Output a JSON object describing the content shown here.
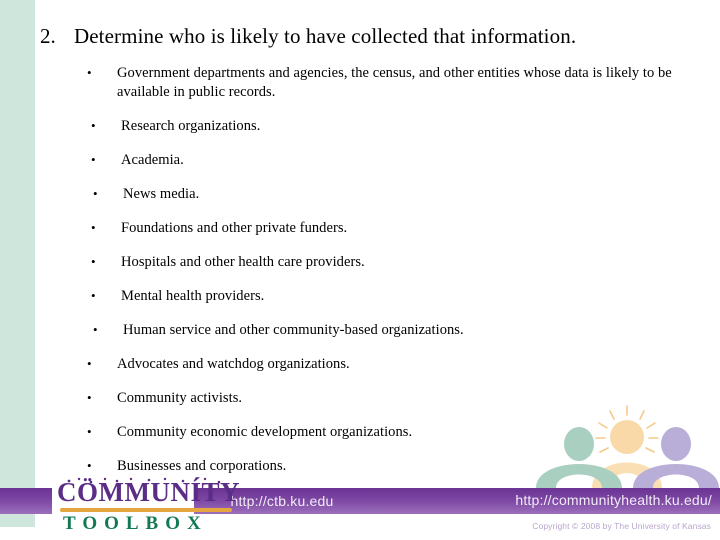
{
  "slide": {
    "title_number": "2.",
    "title_text": "Determine who is likely to have collected that information.",
    "bullets": [
      "Government departments and agencies, the census, and other entities whose data is likely to be available in public records.",
      "Research organizations.",
      "Academia.",
      "News media.",
      "Foundations and other private funders.",
      "Hospitals and other health care providers.",
      "Mental health providers.",
      "Human service and other community-based organizations.",
      "Advocates and watchdog organizations.",
      "Community activists.",
      "Community economic development organizations.",
      "Businesses and corporations."
    ],
    "bullet_marker": "•"
  },
  "footer": {
    "logo_line1": "CÖMMUNÍTY",
    "logo_line2": "TOOLBOX",
    "url_left": "http://ctb.ku.edu",
    "url_right": "http://communityhealth.ku.edu/",
    "copyright": "Copyright © 2008 by The University of Kansas"
  },
  "colors": {
    "band_green": "#cfe6dc",
    "footer_purple": "#7c46a2",
    "logo_purple": "#5b2d86",
    "logo_green": "#127a52",
    "logo_orange": "#e6a63f",
    "figure_green": "#a8cfc0",
    "figure_purple": "#b9aed8",
    "figure_orange": "#fad9a8"
  }
}
